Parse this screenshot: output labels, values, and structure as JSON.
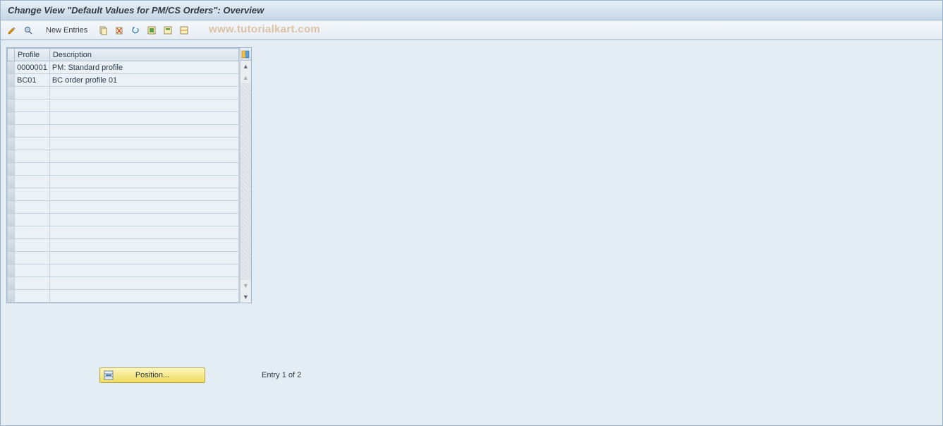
{
  "header": {
    "title": "Change View \"Default Values for PM/CS Orders\": Overview"
  },
  "toolbar": {
    "new_entries_label": "New Entries"
  },
  "watermark": "www.tutorialkart.com",
  "table": {
    "columns": {
      "profile": "Profile",
      "description": "Description"
    },
    "rows": [
      {
        "profile": "0000001",
        "description": "PM: Standard profile"
      },
      {
        "profile": "BC01",
        "description": "BC order profile 01"
      }
    ],
    "empty_rows": 17
  },
  "footer": {
    "position_label": "Position...",
    "entry_text": "Entry 1 of 2"
  }
}
